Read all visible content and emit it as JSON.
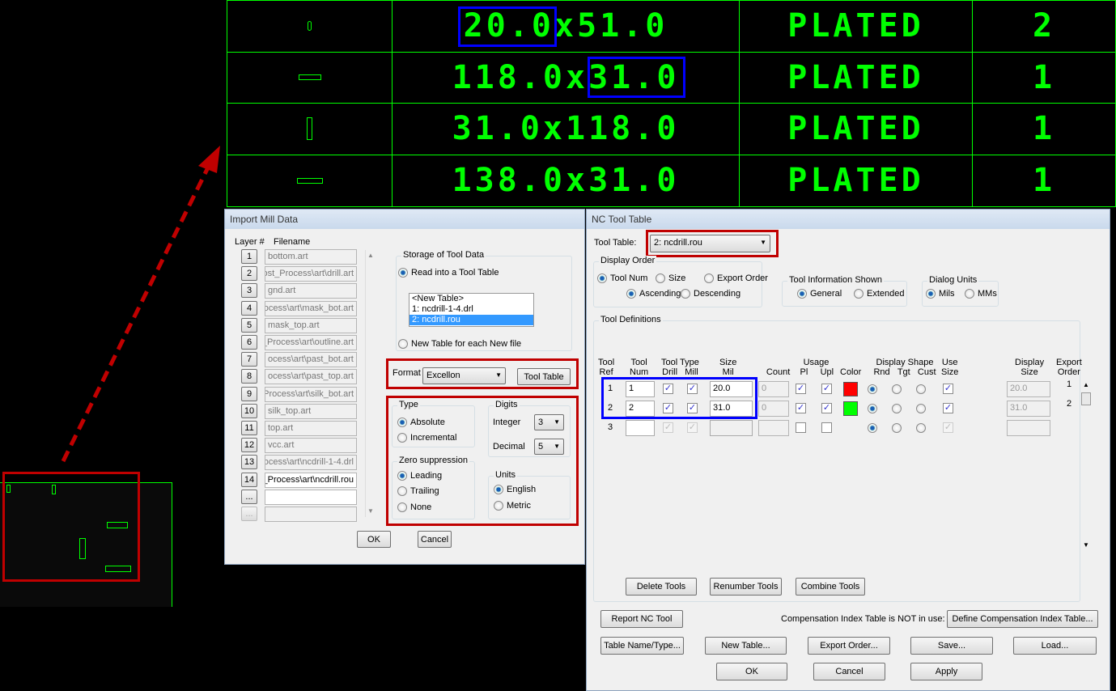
{
  "drill_table": {
    "rows": [
      {
        "size": "20.0x51.0",
        "plating": "PLATED",
        "qty": "2"
      },
      {
        "size": "118.0x31.0",
        "plating": "PLATED",
        "qty": "1"
      },
      {
        "size": "31.0x118.0",
        "plating": "PLATED",
        "qty": "1"
      },
      {
        "size": "138.0x31.0",
        "plating": "PLATED",
        "qty": "1"
      }
    ]
  },
  "import": {
    "title": "Import Mill Data",
    "layer_header": "Layer #",
    "filename_header": "Filename",
    "layers": [
      {
        "n": "1",
        "f": "bottom.art"
      },
      {
        "n": "2",
        "f": "ost_Process\\art\\drill.art"
      },
      {
        "n": "3",
        "f": "gnd.art"
      },
      {
        "n": "4",
        "f": "ocess\\art\\mask_bot.art"
      },
      {
        "n": "5",
        "f": "mask_top.art"
      },
      {
        "n": "6",
        "f": "_Process\\art\\outline.art"
      },
      {
        "n": "7",
        "f": "ocess\\art\\past_bot.art"
      },
      {
        "n": "8",
        "f": "ocess\\art\\past_top.art"
      },
      {
        "n": "9",
        "f": "Process\\art\\silk_bot.art"
      },
      {
        "n": "10",
        "f": "silk_top.art"
      },
      {
        "n": "11",
        "f": "top.art"
      },
      {
        "n": "12",
        "f": "vcc.art"
      },
      {
        "n": "13",
        "f": "ocess\\art\\ncdrill-1-4.drl"
      },
      {
        "n": "14",
        "f": "_Process\\art\\ncdrill.rou"
      },
      {
        "n": "...",
        "f": ""
      },
      {
        "n": "...",
        "f": ""
      }
    ],
    "storage": "Storage of Tool Data",
    "read_into": "Read into a Tool Table",
    "tables": [
      "<New Table>",
      "1: ncdrill-1-4.drl",
      "2: ncdrill.rou"
    ],
    "new_table_each": "New Table for each New file",
    "format_label": "Format",
    "format": "Excellon",
    "tool_table_btn": "Tool Table",
    "type": "Type",
    "absolute": "Absolute",
    "incremental": "Incremental",
    "digits": "Digits",
    "integer": "Integer",
    "integer_val": "3",
    "decimal": "Decimal",
    "decimal_val": "5",
    "zero": "Zero suppression",
    "leading": "Leading",
    "trailing": "Trailing",
    "none": "None",
    "units": "Units",
    "english": "English",
    "metric": "Metric",
    "ok": "OK",
    "cancel": "Cancel"
  },
  "nc": {
    "title": "NC Tool Table",
    "tool_table_label": "Tool Table:",
    "tool_table": "2: ncdrill.rou",
    "display_order": "Display Order",
    "tool_num": "Tool Num",
    "size": "Size",
    "export_order": "Export Order",
    "ascending": "Ascending",
    "descending": "Descending",
    "info": "Tool Information Shown",
    "general": "General",
    "extended": "Extended",
    "units": "Dialog Units",
    "mils": "Mils",
    "mms": "MMs",
    "defs": "Tool Definitions",
    "h": {
      "tool": "Tool",
      "ref": "Ref",
      "num": "Num",
      "tooltype": "Tool Type",
      "drill": "Drill",
      "mill": "Mill",
      "size": "Size",
      "mil": "Mil",
      "usage": "Usage",
      "count": "Count",
      "pl": "Pl",
      "upl": "Upl",
      "color": "Color",
      "dshape": "Display Shape",
      "rnd": "Rnd",
      "tgt": "Tgt",
      "cust": "Cust",
      "use": "Use",
      "usize": "Size",
      "display": "Display",
      "dsize": "Size",
      "export": "Export",
      "order": "Order"
    },
    "rows": [
      {
        "ref": "1",
        "num": "1",
        "size": "20.0",
        "count": "0",
        "color": "#ff0000",
        "dsize": "20.0",
        "order": "1"
      },
      {
        "ref": "2",
        "num": "2",
        "size": "31.0",
        "count": "0",
        "color": "#00ff00",
        "dsize": "31.0",
        "order": "2"
      },
      {
        "ref": "3",
        "num": "",
        "size": "",
        "count": "",
        "dsize": "",
        "order": ""
      }
    ],
    "delete": "Delete Tools",
    "renumber": "Renumber Tools",
    "combine": "Combine Tools",
    "report": "Report NC Tool",
    "comp_text": "Compensation Index Table is NOT in use:",
    "define_comp": "Define Compensation Index Table...",
    "table_name": "Table Name/Type...",
    "new_table": "New Table...",
    "export_btn": "Export Order...",
    "save": "Save...",
    "load": "Load...",
    "ok": "OK",
    "cancel": "Cancel",
    "apply": "Apply"
  }
}
